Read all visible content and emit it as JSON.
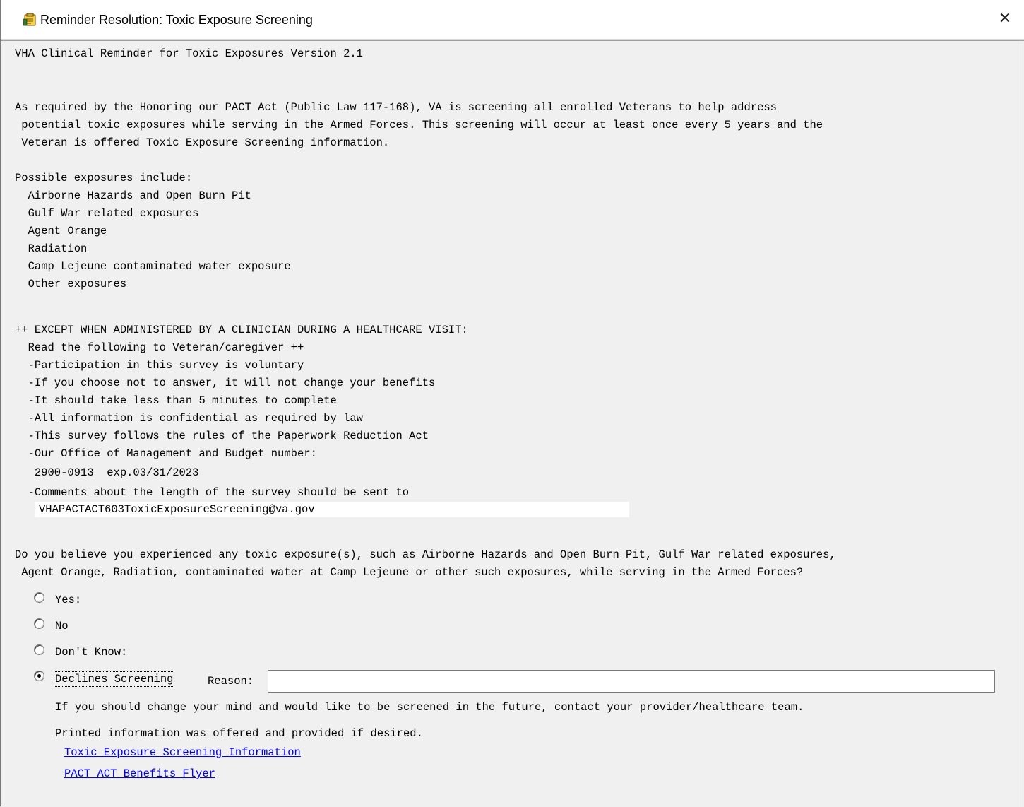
{
  "window": {
    "title": "Reminder Resolution: Toxic Exposure Screening",
    "close_glyph": "✕",
    "icon": "reminder-clipboard-icon"
  },
  "header": "VHA Clinical Reminder for Toxic Exposures Version 2.1",
  "intro": [
    "As required by the Honoring our PACT Act (Public Law 117-168), VA is screening all enrolled Veterans to help address",
    " potential toxic exposures while serving in the Armed Forces. This screening will occur at least once every 5 years and the",
    " Veteran is offered Toxic Exposure Screening information."
  ],
  "exposures": {
    "heading": "Possible exposures include:",
    "items": [
      "  Airborne Hazards and Open Burn Pit",
      "  Gulf War related exposures",
      "  Agent Orange",
      "  Radiation",
      "  Camp Lejeune contaminated water exposure",
      "  Other exposures"
    ]
  },
  "notice": {
    "lines": [
      "++ EXCEPT WHEN ADMINISTERED BY A CLINICIAN DURING A HEALTHCARE VISIT:",
      "  Read the following to Veteran/caregiver ++",
      "  -Participation in this survey is voluntary",
      "  -If you choose not to answer, it will not change your benefits",
      "  -It should take less than 5 minutes to complete",
      "  -All information is confidential as required by law",
      "  -This survey follows the rules of the Paperwork Reduction Act",
      "  -Our Office of Management and Budget number:",
      "   2900-0913  exp.03/31/2023",
      "  -Comments about the length of the survey should be sent to"
    ],
    "email": "VHAPACTACT603ToxicExposureScreening@va.gov"
  },
  "question": [
    "Do you believe you experienced any toxic exposure(s), such as Airborne Hazards and Open Burn Pit, Gulf War related exposures,",
    " Agent Orange, Radiation, contaminated water at Camp Lejeune or other such exposures, while serving in the Armed Forces?"
  ],
  "options": {
    "yes": "Yes:",
    "no": "No",
    "dont_know": "Don't Know:",
    "declines": "Declines Screening",
    "selected": "declines"
  },
  "reason": {
    "label": "Reason:",
    "value": ""
  },
  "declines_info": {
    "change_mind": "If you should change your mind and would like to be screened in the future, contact your provider/healthcare team.",
    "printed": "Printed information was offered and provided if desired."
  },
  "links": {
    "screening_info": "Toxic Exposure Screening Information",
    "benefits_flyer": "PACT ACT Benefits Flyer"
  },
  "colors": {
    "link": "#0000ee",
    "background": "#f0f0f0"
  }
}
